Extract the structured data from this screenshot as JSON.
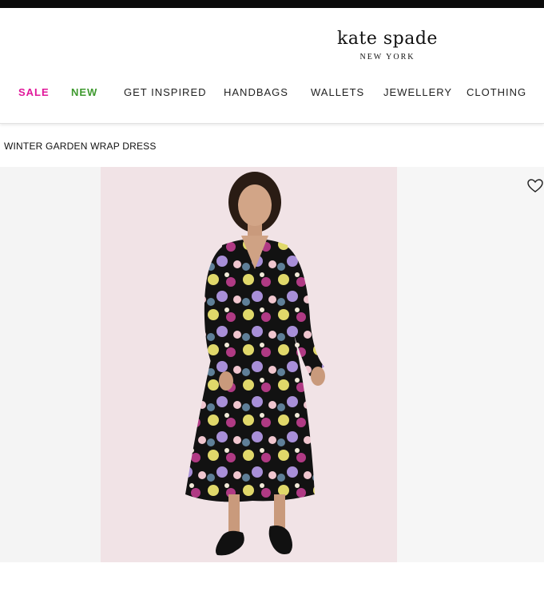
{
  "brand": {
    "name": "kate spade",
    "location": "NEW YORK"
  },
  "nav": {
    "sale": "SALE",
    "new": "NEW",
    "get_inspired": "GET INSPIRED",
    "handbags": "HANDBAGS",
    "wallets": "WALLETS",
    "jewellery": "JEWELLERY",
    "clothing": "CLOTHING"
  },
  "colors": {
    "sale": "#e0179a",
    "new": "#3f9a2f",
    "photo_background": "#f1e3e6"
  },
  "product": {
    "title": "WINTER GARDEN WRAP DRESS"
  },
  "icons": {
    "wishlist": "heart-outline-icon"
  }
}
